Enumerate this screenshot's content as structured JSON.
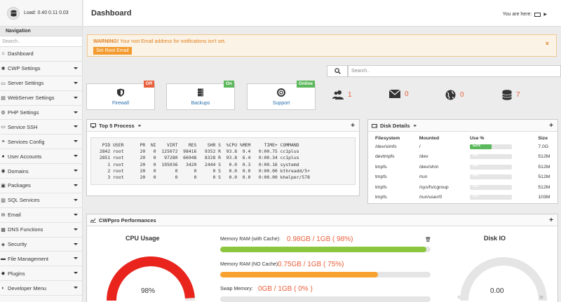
{
  "load": {
    "text": "Load: 0.40  0.11  0.03"
  },
  "nav": {
    "title": "Navigation",
    "search_placeholder": "Search..",
    "items": [
      {
        "label": "Dashboard",
        "icon": "home-icon",
        "glyph": "⌂",
        "caret": false
      },
      {
        "label": "CWP Settings",
        "icon": "wrench-icon",
        "glyph": "✱",
        "caret": true
      },
      {
        "label": "Server Settings",
        "icon": "server-icon",
        "glyph": "▭",
        "caret": true
      },
      {
        "label": "WebServer Settings",
        "icon": "webserver-icon",
        "glyph": "▤",
        "caret": true
      },
      {
        "label": "PHP Settings",
        "icon": "gear-icon",
        "glyph": "⚙",
        "caret": true
      },
      {
        "label": "Service SSH",
        "icon": "monitor-icon",
        "glyph": "▭",
        "caret": true
      },
      {
        "label": "Services Config",
        "icon": "list-icon",
        "glyph": "≡",
        "caret": true
      },
      {
        "label": "User Accounts",
        "icon": "user-icon",
        "glyph": "●",
        "caret": true
      },
      {
        "label": "Domains",
        "icon": "globe-icon",
        "glyph": "◉",
        "caret": true
      },
      {
        "label": "Packages",
        "icon": "box-icon",
        "glyph": "▣",
        "caret": true
      },
      {
        "label": "SQL Services",
        "icon": "database-icon",
        "glyph": "▥",
        "caret": true
      },
      {
        "label": "Email",
        "icon": "mail-icon",
        "glyph": "✉",
        "caret": true
      },
      {
        "label": "DNS Functions",
        "icon": "dns-icon",
        "glyph": "▦",
        "caret": true
      },
      {
        "label": "Security",
        "icon": "shield-icon",
        "glyph": "◈",
        "caret": true
      },
      {
        "label": "File Management",
        "icon": "folder-icon",
        "glyph": "▬",
        "caret": true
      },
      {
        "label": "Plugins",
        "icon": "plugin-icon",
        "glyph": "◆",
        "caret": true
      },
      {
        "label": "Developer Menu",
        "icon": "code-icon",
        "glyph": "◐",
        "caret": true
      }
    ]
  },
  "header": {
    "title": "Dashboard",
    "breadcrumb": "You are here:"
  },
  "warning": {
    "bold": "WARNING!",
    "text": " Your root Email address for notifications isn't set.",
    "button": "Set Root Email"
  },
  "search": {
    "placeholder": "Search.."
  },
  "services": [
    {
      "label": "Firewall",
      "badge": "Off",
      "badge_color": "#e8603c",
      "icon": "firewall-icon"
    },
    {
      "label": "Backups",
      "badge": "On",
      "badge_color": "#5cb85c",
      "icon": "backups-icon"
    },
    {
      "label": "Support",
      "badge": "Online",
      "badge_color": "#5cb85c",
      "icon": "support-icon"
    }
  ],
  "stats": [
    {
      "value": "1",
      "icon": "users-icon"
    },
    {
      "value": "0",
      "icon": "mail-icon"
    },
    {
      "value": "0",
      "icon": "globe-icon"
    },
    {
      "value": "7",
      "icon": "database-icon"
    }
  ],
  "top5": {
    "title": "Top 5 Process",
    "lines": "  PID USER      PR  NI    VIRT    RES    SHR S  %CPU %MEM     TIME+ COMMAND\n 2842 root      20   0  125072  98416   9352 R  93.8  9.4   0:00.75 cc1plus\n 2851 root      20   0   97280  66948   8328 R  93.8  6.4   0:00.34 cc1plus\n    1 root      20   0  195036   3420   2444 S   0.0  0.3   0:00.16 systemd\n    2 root      20   0       0      0      0 S   0.0  0.0   0:00.00 kthreadd/5+\n    3 root      20   0       0      0      0 S   0.0  0.0   0:00.00 khelper/578"
  },
  "disk": {
    "title": "Disk Details",
    "headers": [
      "Filesystem",
      "Mounted",
      "Use %",
      "Size"
    ],
    "rows": [
      {
        "fs": "/dev/simfs",
        "mount": "/",
        "use": "52%",
        "pct": 0.52,
        "size": "7.0G"
      },
      {
        "fs": "devtmpfs",
        "mount": "/dev",
        "use": "0%",
        "pct": 0,
        "size": "512M"
      },
      {
        "fs": "tmpfs",
        "mount": "/dev/shm",
        "use": "0%",
        "pct": 0,
        "size": "512M"
      },
      {
        "fs": "tmpfs",
        "mount": "/run",
        "use": "0%",
        "pct": 0,
        "size": "512M"
      },
      {
        "fs": "tmpfs",
        "mount": "/sys/fs/cgroup",
        "use": "0%",
        "pct": 0,
        "size": "512M"
      },
      {
        "fs": "tmpfs",
        "mount": "/run/user/0",
        "use": "0%",
        "pct": 0,
        "size": "103M"
      }
    ]
  },
  "perf": {
    "title": "CWPpro Performances",
    "cpu_title": "CPU Usage",
    "cpu_value": "98%",
    "cpu_pct": 0.98,
    "ram_cache_label": "Memory RAM (with Cache):",
    "ram_cache_value": "0.98GB / 1GB ( 98%)",
    "ram_cache_pct": 0.98,
    "ram_nocache_label": "Memory RAM (NO Cache):",
    "ram_nocache_value": "0.75GB / 1GB ( 75%)",
    "ram_nocache_pct": 0.75,
    "swap_label": "Swap Memory:",
    "swap_value": "0GB / 1GB ( 0% )",
    "swap_pct": 0,
    "diskio_title": "Disk IO",
    "diskio_value": "0.00",
    "diskio_min": "0",
    "diskio_max": "15"
  },
  "colors": {
    "warning": "#e0801f",
    "green": "#5cb85c",
    "orange": "#f29a2e",
    "red": "#e8241c",
    "accent": "#e8603c"
  }
}
